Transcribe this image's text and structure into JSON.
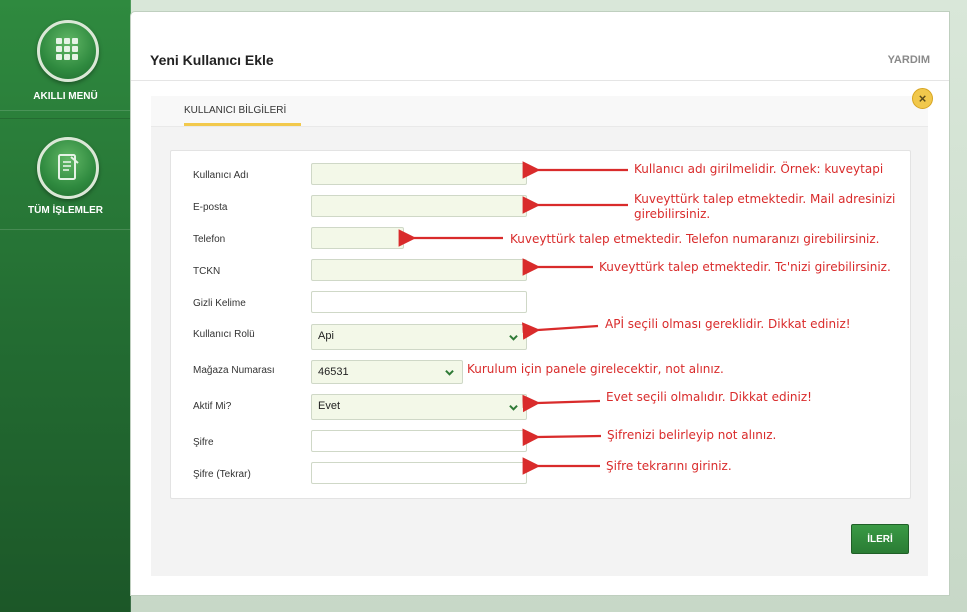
{
  "sidebar": {
    "items": [
      {
        "label": "AKILLI MENÜ",
        "icon": "grid-menu-icon"
      },
      {
        "label": "TÜM İŞLEMLER",
        "icon": "document-icon"
      }
    ]
  },
  "header": {
    "title": "Yeni Kullanıcı Ekle",
    "help": "YARDIM"
  },
  "tabs": [
    {
      "label": "KULLANICI BİLGİLERİ",
      "active": true
    }
  ],
  "form": {
    "fields": [
      {
        "label": "Kullanıcı Adı",
        "type": "text",
        "value": ""
      },
      {
        "label": "E-posta",
        "type": "text",
        "value": ""
      },
      {
        "label": "Telefon",
        "type": "text",
        "value": ""
      },
      {
        "label": "TCKN",
        "type": "text",
        "value": ""
      },
      {
        "label": "Gizli Kelime",
        "type": "text",
        "value": ""
      },
      {
        "label": "Kullanıcı Rolü",
        "type": "select",
        "value": "Api"
      },
      {
        "label": "Mağaza Numarası",
        "type": "select",
        "value": "46531"
      },
      {
        "label": "Aktif Mi?",
        "type": "select",
        "value": "Evet"
      },
      {
        "label": "Şifre",
        "type": "password",
        "value": ""
      },
      {
        "label": "Şifre (Tekrar)",
        "type": "password",
        "value": ""
      }
    ],
    "next_label": "İLERİ"
  },
  "annotations": [
    "Kullanıcı adı girilmelidir. Örnek: kuveytapi",
    "Kuveyttürk talep etmektedir. Mail adresinizi girebilirsiniz.",
    "Kuveyttürk talep etmektedir. Telefon numaranızı girebilirsiniz.",
    "Kuveyttürk talep etmektedir. Tc'nizi girebilirsiniz.",
    "APİ seçili olması gereklidir. Dikkat ediniz!",
    "Kurulum için panele girelecektir, not alınız.",
    "Evet seçili olmalıdır. Dikkat ediniz!",
    "Şifrenizi belirleyip not alınız.",
    "Şifre tekrarını giriniz."
  ],
  "colors": {
    "brand_green": "#2f8a3f",
    "accent_yellow": "#f2c94c",
    "annotation_red": "#d92b2b"
  }
}
